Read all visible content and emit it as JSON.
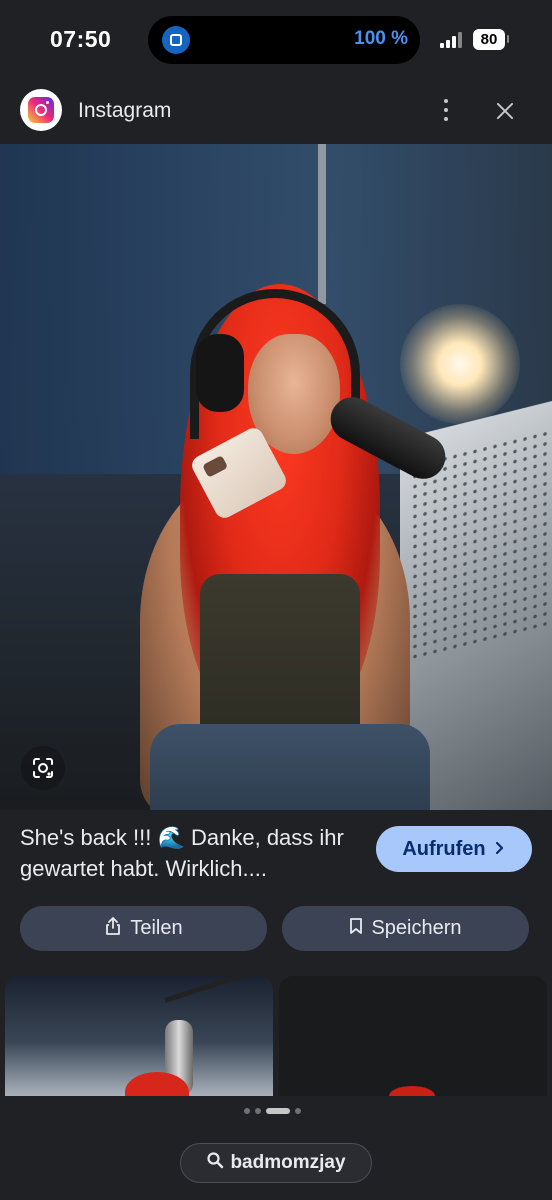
{
  "status_bar": {
    "time": "07:50",
    "activity_percent": "100 %",
    "battery": "80"
  },
  "header": {
    "app_name": "Instagram",
    "logo_icon": "instagram-logo",
    "more_icon": "more-vert-icon",
    "close_icon": "close-icon"
  },
  "caption": {
    "text": "She's back !!! 🌊 Danke, dass ihr gewartet habt. Wirklich...."
  },
  "visit_button": {
    "label": "Aufrufen",
    "icon": "chevron-right-icon"
  },
  "actions": {
    "share_label": "Teilen",
    "share_icon": "share-icon",
    "save_label": "Speichern",
    "save_icon": "bookmark-icon"
  },
  "lens_icon": "google-lens-icon",
  "pagination": {
    "count": 4,
    "active_index": 2
  },
  "source_chip": {
    "label": "badmomzjay",
    "icon": "search-icon"
  },
  "colors": {
    "background": "#1f2125",
    "accent_button": "#a8c7fa",
    "secondary_button": "#3b4355",
    "activity_blue": "#4a90f0"
  }
}
